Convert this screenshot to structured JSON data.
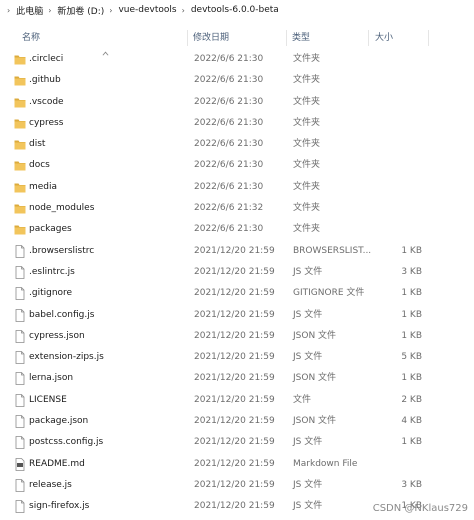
{
  "breadcrumb": [
    "此电脑",
    "新加卷 (D:)",
    "vue-devtools",
    "devtools-6.0.0-beta"
  ],
  "columns": {
    "name": "名称",
    "date": "修改日期",
    "type": "类型",
    "size": "大小"
  },
  "files": [
    {
      "name": ".circleci",
      "date": "2022/6/6 21:30",
      "type": "文件夹",
      "size": "",
      "icon": "folder-icon"
    },
    {
      "name": ".github",
      "date": "2022/6/6 21:30",
      "type": "文件夹",
      "size": "",
      "icon": "folder-icon"
    },
    {
      "name": ".vscode",
      "date": "2022/6/6 21:30",
      "type": "文件夹",
      "size": "",
      "icon": "folder-icon"
    },
    {
      "name": "cypress",
      "date": "2022/6/6 21:30",
      "type": "文件夹",
      "size": "",
      "icon": "folder-icon"
    },
    {
      "name": "dist",
      "date": "2022/6/6 21:30",
      "type": "文件夹",
      "size": "",
      "icon": "folder-icon"
    },
    {
      "name": "docs",
      "date": "2022/6/6 21:30",
      "type": "文件夹",
      "size": "",
      "icon": "folder-icon"
    },
    {
      "name": "media",
      "date": "2022/6/6 21:30",
      "type": "文件夹",
      "size": "",
      "icon": "folder-icon"
    },
    {
      "name": "node_modules",
      "date": "2022/6/6 21:32",
      "type": "文件夹",
      "size": "",
      "icon": "folder-icon"
    },
    {
      "name": "packages",
      "date": "2022/6/6 21:30",
      "type": "文件夹",
      "size": "",
      "icon": "folder-icon"
    },
    {
      "name": ".browserslistrc",
      "date": "2021/12/20 21:59",
      "type": "BROWSERSLIST...",
      "size": "1 KB",
      "icon": "file-icon"
    },
    {
      "name": ".eslintrc.js",
      "date": "2021/12/20 21:59",
      "type": "JS 文件",
      "size": "3 KB",
      "icon": "file-icon"
    },
    {
      "name": ".gitignore",
      "date": "2021/12/20 21:59",
      "type": "GITIGNORE 文件",
      "size": "1 KB",
      "icon": "file-icon"
    },
    {
      "name": "babel.config.js",
      "date": "2021/12/20 21:59",
      "type": "JS 文件",
      "size": "1 KB",
      "icon": "file-icon"
    },
    {
      "name": "cypress.json",
      "date": "2021/12/20 21:59",
      "type": "JSON 文件",
      "size": "1 KB",
      "icon": "file-icon"
    },
    {
      "name": "extension-zips.js",
      "date": "2021/12/20 21:59",
      "type": "JS 文件",
      "size": "5 KB",
      "icon": "file-icon"
    },
    {
      "name": "lerna.json",
      "date": "2021/12/20 21:59",
      "type": "JSON 文件",
      "size": "1 KB",
      "icon": "file-icon"
    },
    {
      "name": "LICENSE",
      "date": "2021/12/20 21:59",
      "type": "文件",
      "size": "2 KB",
      "icon": "file-icon"
    },
    {
      "name": "package.json",
      "date": "2021/12/20 21:59",
      "type": "JSON 文件",
      "size": "4 KB",
      "icon": "file-icon"
    },
    {
      "name": "postcss.config.js",
      "date": "2021/12/20 21:59",
      "type": "JS 文件",
      "size": "1 KB",
      "icon": "file-icon"
    },
    {
      "name": "README.md",
      "date": "2021/12/20 21:59",
      "type": "Markdown File",
      "size": "",
      "icon": "markdown-file-icon"
    },
    {
      "name": "release.js",
      "date": "2021/12/20 21:59",
      "type": "JS 文件",
      "size": "3 KB",
      "icon": "file-icon"
    },
    {
      "name": "sign-firefox.js",
      "date": "2021/12/20 21:59",
      "type": "JS 文件",
      "size": "1 KB",
      "icon": "file-icon"
    }
  ],
  "watermark": "CSDN @NKlaus729",
  "colors": {
    "folder": "#f2c55c",
    "folder_dark": "#dcab3c",
    "header_text": "#4c607a"
  }
}
